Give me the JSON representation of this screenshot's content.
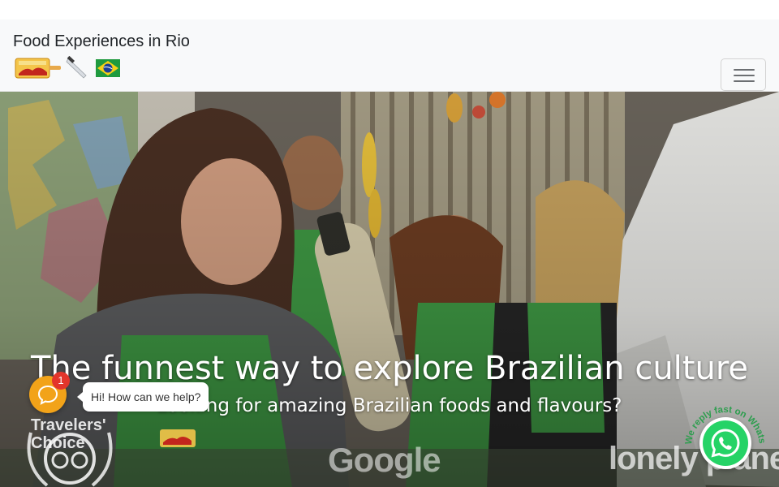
{
  "navbar": {
    "brand_title": "Food Experiences in Rio",
    "brand_icons": [
      "cook-in-rio-logo",
      "chef-knife-icon",
      "brazil-flag-icon"
    ],
    "toggler_icon": "hamburger-menu-icon"
  },
  "hero": {
    "title": "The funnest way to explore Brazilian culture",
    "subtitle": "Looking for amazing Brazilian foods and flavours?",
    "badges": {
      "tripadvisor_text_1": "Travelers'",
      "tripadvisor_text_2": "Choice",
      "google": "Google",
      "lonely_planet": "lonely planet"
    }
  },
  "chat_widget": {
    "icon": "chat-bubble-icon",
    "unread_count": "1",
    "greeting": "Hi! How can we help?"
  },
  "whatsapp": {
    "icon": "whatsapp-icon",
    "label": "We reply fast on WhatsApp"
  },
  "colors": {
    "navbar_bg": "#f8f9fa",
    "chat_orange": "#f2a319",
    "badge_red": "#e3352b",
    "whatsapp_green": "#25d366",
    "apron_green": "#3f9a44"
  }
}
